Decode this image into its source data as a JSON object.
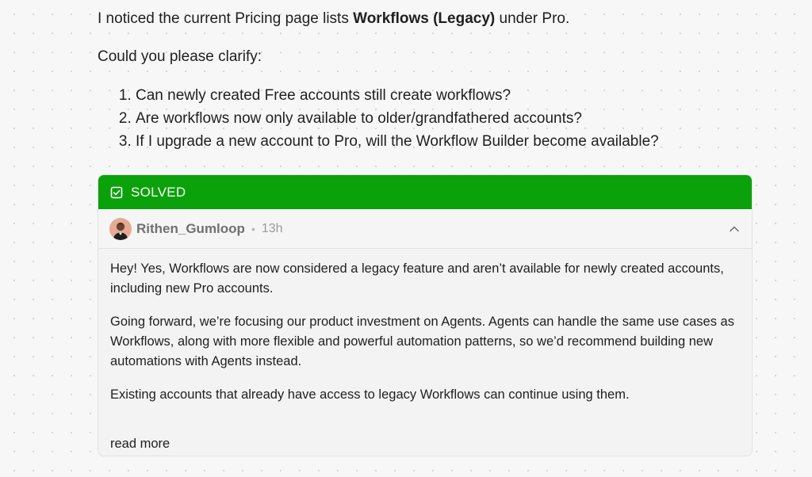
{
  "question": {
    "intro_prefix": "I noticed the current Pricing page lists ",
    "intro_bold": "Workflows (Legacy)",
    "intro_suffix": " under Pro.",
    "ask": "Could you please clarify:",
    "items": [
      "Can newly created Free accounts still create workflows?",
      "Are workflows now only available to older/grandfathered accounts?",
      "If I upgrade a new account to Pro, will the Workflow Builder become available?"
    ]
  },
  "answer": {
    "status_label": "SOLVED",
    "status_color": "#0ba10b",
    "author": "Rithen_Gumloop",
    "separator": "•",
    "age": "13h",
    "paragraphs": [
      "Hey! Yes, Workflows are now considered a legacy feature and aren’t available for newly created accounts, including new Pro accounts.",
      "Going forward, we’re focusing our product investment on Agents. Agents can handle the same use cases as Workflows, along with more flexible and powerful automation patterns, so we’d recommend building new automations with Agents instead.",
      "Existing accounts that already have access to legacy Workflows can continue using them."
    ],
    "read_more": "read more",
    "icons": {
      "status": "check-square-icon",
      "collapse": "chevron-up-icon"
    }
  }
}
